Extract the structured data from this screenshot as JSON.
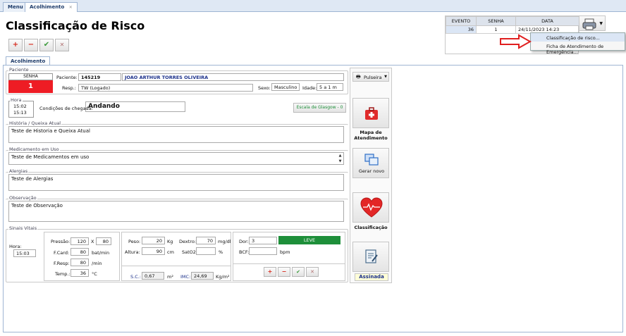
{
  "tabs": {
    "menu": "Menu",
    "acolhimento": "Acolhimento"
  },
  "page_title": "Classificação de Risco",
  "toolbar": {
    "add": "+",
    "remove": "−",
    "confirm": "✔",
    "cancel": "✕"
  },
  "event_table": {
    "headers": [
      "EVENTO",
      "SENHA",
      "DATA"
    ],
    "row": [
      "36",
      "1",
      "24/11/2023 14:23"
    ]
  },
  "context_menu": {
    "items": [
      "Classificação de risco...",
      "Ficha de Atendimento de Emergência..."
    ]
  },
  "panel_tab": "Acolhimento",
  "paciente": {
    "legend": "Paciente",
    "senha_label": "SENHA",
    "senha_value": "1",
    "paciente_label": "Paciente:",
    "paciente_id": "145219",
    "paciente_name": "JOAO ARTHUR TORRES OLIVEIRA",
    "resp_label": "Resp.:",
    "resp_value": "TW (Logado)",
    "sexo_label": "Sexo:",
    "sexo_value": "Masculino",
    "idade_label": "Idade:",
    "idade_value": "5 a 1 m"
  },
  "hora": {
    "legend": "Hora",
    "time1": "15:02",
    "time2": "15:13",
    "condicoes_label": "Condições de chegada:",
    "condicoes_value": "Andando",
    "glasgow": "Escala de Glasgow - 0"
  },
  "historia": {
    "legend": "História / Queixa Atual",
    "value": "Teste de Historia e Queixa Atual"
  },
  "medicamento": {
    "legend": "Medicamento em Uso",
    "value": "Teste de Medicamentos em uso"
  },
  "alergias": {
    "legend": "Alergias",
    "value": "Teste de Alergias"
  },
  "observacao": {
    "legend": "Observação",
    "value": "Teste de Observação"
  },
  "sinais": {
    "legend": "Sinais Vitais",
    "hora_label": "Hora:",
    "hora_value": "15:03",
    "pressao_label": "Pressão:",
    "pressao_sys": "120",
    "pressao_x": "X",
    "pressao_dia": "80",
    "fcard_label": "F.Card:",
    "fcard_value": "80",
    "fcard_unit": "bat/min",
    "fresp_label": "F.Resp:",
    "fresp_value": "80",
    "fresp_unit": "/min",
    "temp_label": "Temp.:",
    "temp_value": "36",
    "temp_unit": "°C",
    "peso_label": "Peso:",
    "peso_value": "20",
    "peso_unit": "Kg",
    "altura_label": "Altura:",
    "altura_value": "90",
    "altura_unit": "cm",
    "dextro_label": "Dextro:",
    "dextro_value": "70",
    "dextro_unit": "mg/dl",
    "sat_label": "SatO2:",
    "sat_unit": "%",
    "sc_label": "S.C.:",
    "sc_value": "0,67",
    "sc_unit": "m²",
    "imc_label": "IMC:",
    "imc_value": "24,69",
    "imc_unit": "Kg/m²",
    "dor_label": "Dor:",
    "dor_value": "3",
    "dor_level": "LEVE",
    "bcf_label": "BCF:",
    "bcf_unit": "bpm"
  },
  "side": {
    "pulseira": "Pulseira",
    "mapa": "Mapa de Atendimento",
    "gerar": "Gerar novo",
    "classificacao": "Classificação",
    "assinada": "Assinada"
  },
  "colors": {
    "senha_red": "#ee1c24",
    "leve_green": "#1e8f3a",
    "panel_border": "#9fb5d3"
  }
}
